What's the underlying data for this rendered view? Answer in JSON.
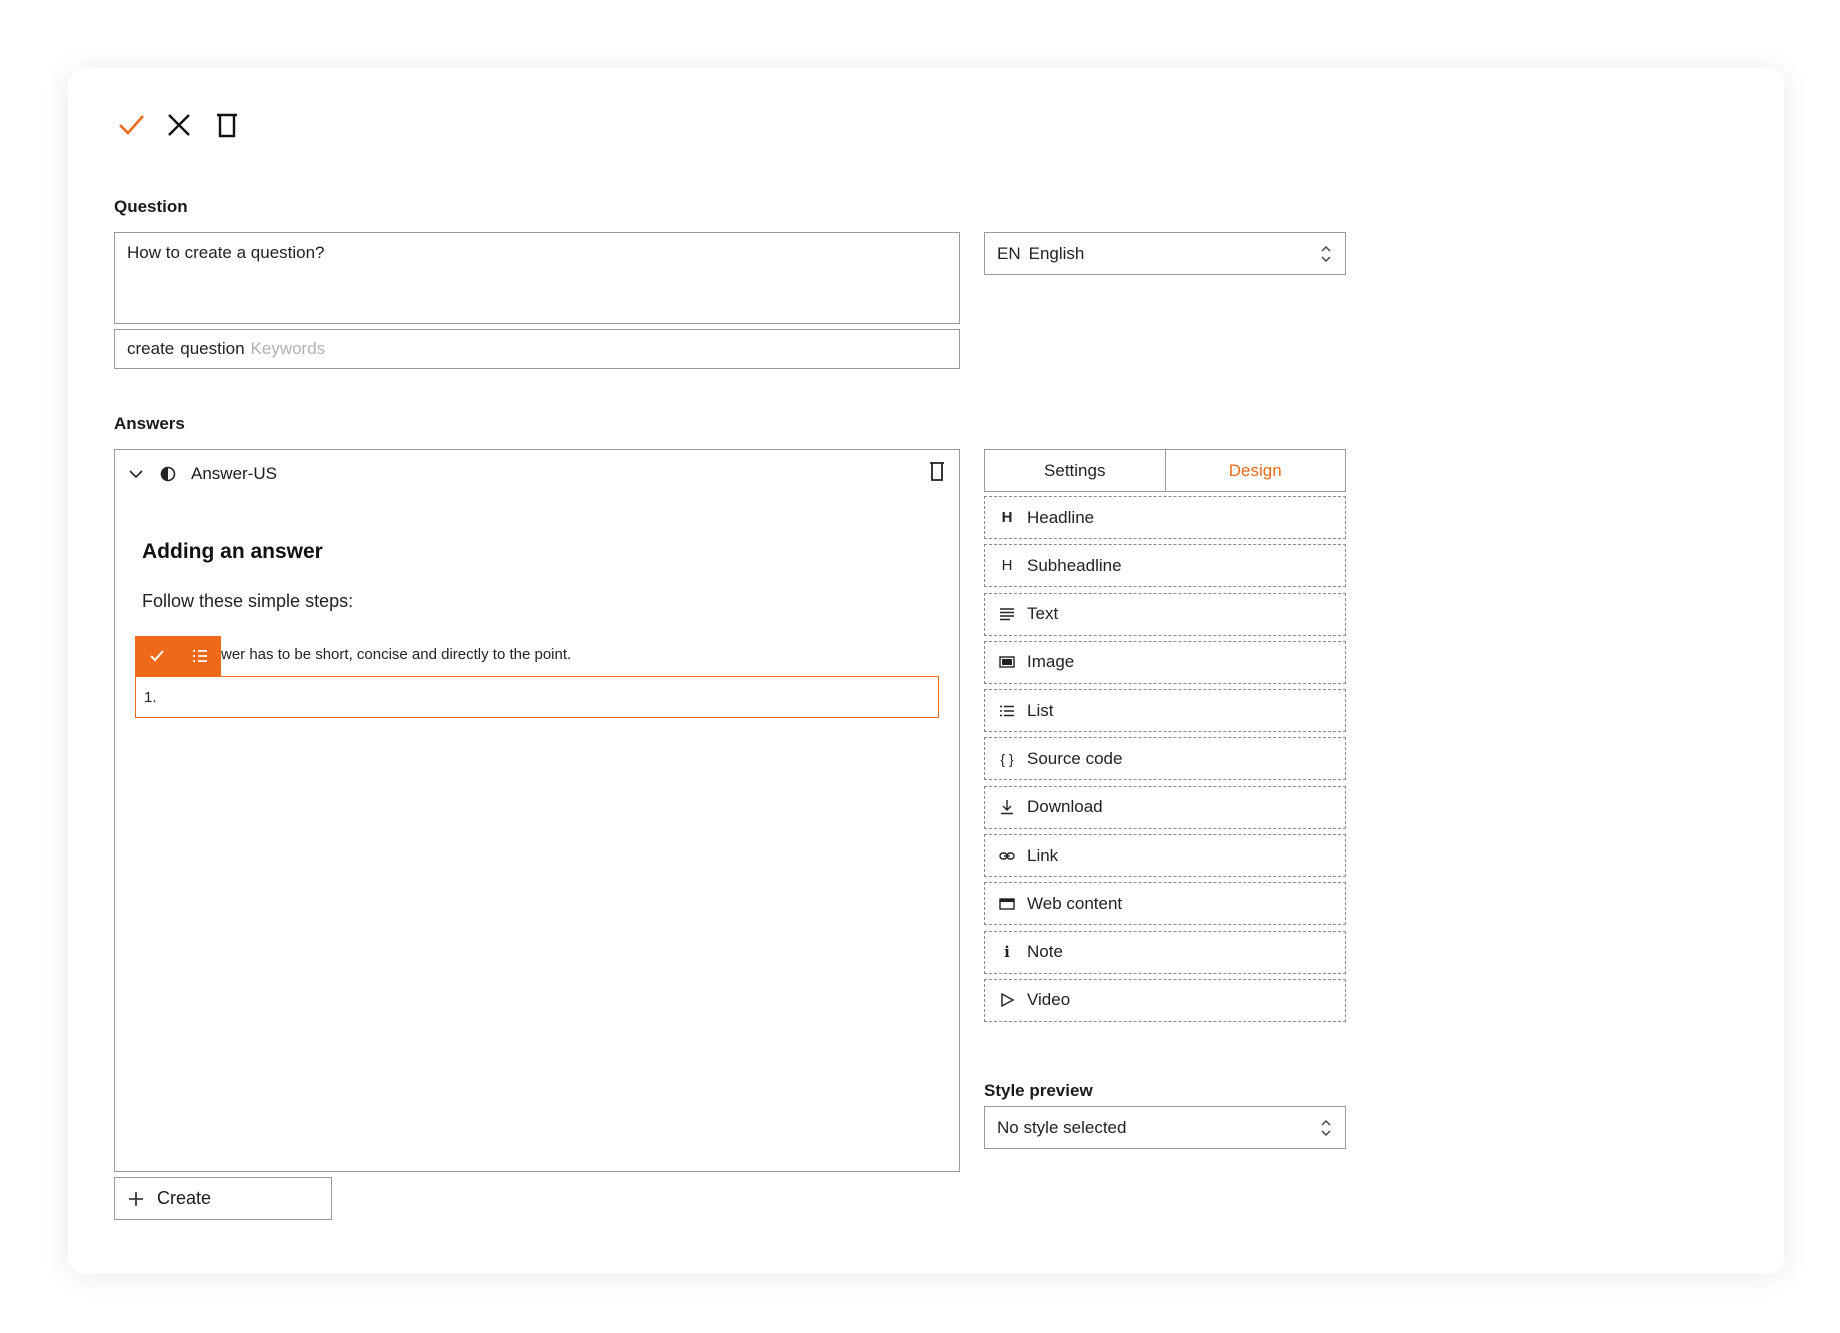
{
  "toolbar": {
    "confirm_icon": "check-icon",
    "cancel_icon": "close-icon",
    "delete_icon": "trash-icon",
    "accent_color": "#ee6a1a"
  },
  "question": {
    "label": "Question",
    "text": "How to create a question?",
    "keywords": [
      "create",
      "question"
    ],
    "keywords_placeholder": "Keywords"
  },
  "language": {
    "code": "EN",
    "name": "English"
  },
  "answers": {
    "label": "Answers",
    "item": {
      "name": "Answer-US",
      "title": "Adding an answer",
      "text": "Follow these simple steps:",
      "line": "wer has to be short, concise and directly to the point.",
      "list_value": "1."
    },
    "create_label": "Create"
  },
  "tabs": [
    {
      "label": "Settings"
    },
    {
      "label": "Design"
    }
  ],
  "blocks": [
    {
      "label": "Headline",
      "icon": "headline-icon"
    },
    {
      "label": "Subheadline",
      "icon": "subheadline-icon"
    },
    {
      "label": "Text",
      "icon": "text-icon"
    },
    {
      "label": "Image",
      "icon": "image-icon"
    },
    {
      "label": "List",
      "icon": "list-icon"
    },
    {
      "label": "Source code",
      "icon": "source-code-icon"
    },
    {
      "label": "Download",
      "icon": "download-icon"
    },
    {
      "label": "Link",
      "icon": "link-icon"
    },
    {
      "label": "Web content",
      "icon": "web-content-icon"
    },
    {
      "label": "Note",
      "icon": "note-icon"
    },
    {
      "label": "Video",
      "icon": "video-icon"
    }
  ],
  "style_preview": {
    "label": "Style preview",
    "value": "No style selected"
  }
}
